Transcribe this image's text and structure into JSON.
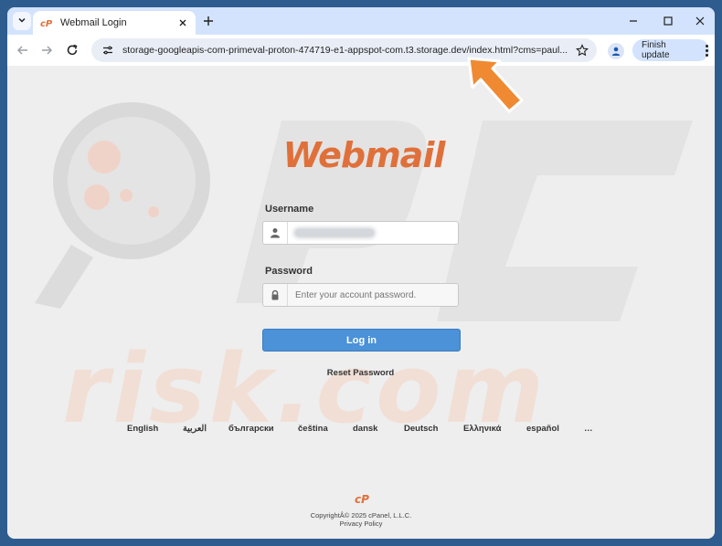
{
  "tab": {
    "title": "Webmail Login"
  },
  "address_bar": {
    "url": "storage-googleapis-com-primeval-proton-474719-e1-appspot-com.t3.storage.dev/index.html?cms=paul..."
  },
  "toolbar": {
    "finish_update_label": "Finish update"
  },
  "login": {
    "logo_text": "Webmail",
    "username_label": "Username",
    "password_label": "Password",
    "password_placeholder": "Enter your account password.",
    "login_button": "Log in",
    "reset_link": "Reset Password"
  },
  "languages": [
    "English",
    "العربية",
    "български",
    "čeština",
    "dansk",
    "Deutsch",
    "Ελληνικά",
    "español",
    "…"
  ],
  "footer": {
    "logo_text": "cP",
    "copyright": "CopyrightÂ© 2025 cPanel, L.L.C.",
    "privacy": "Privacy Policy"
  },
  "colors": {
    "brand_orange": "#e0703a",
    "login_button": "#4b92d8",
    "tab_strip": "#d3e3fd",
    "desktop": "#2f5c8e"
  },
  "icons": [
    "chevron-down-icon",
    "cpanel-favicon-icon",
    "close-icon",
    "plus-icon",
    "minimize-icon",
    "maximize-icon",
    "back-arrow-icon",
    "forward-arrow-icon",
    "reload-icon",
    "site-info-icon",
    "star-icon",
    "profile-icon",
    "kebab-menu-icon",
    "user-icon",
    "lock-icon",
    "orange-arrow-annotation"
  ]
}
